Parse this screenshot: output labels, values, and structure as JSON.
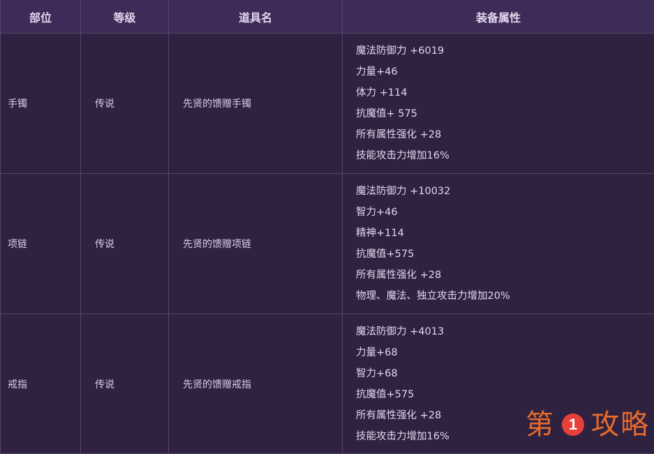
{
  "headers": [
    "部位",
    "等级",
    "道具名",
    "装备属性"
  ],
  "rows": [
    {
      "part": "手镯",
      "grade": "传说",
      "item": "先贤的馈赠手镯",
      "stats": [
        "魔法防御力 +6019",
        "力量+46",
        "体力 +114",
        "抗魔值+ 575",
        "所有属性强化 +28",
        "技能攻击力增加16%"
      ]
    },
    {
      "part": "项链",
      "grade": "传说",
      "item": "先贤的馈赠项链",
      "stats": [
        "魔法防御力 +10032",
        "智力+46",
        "精神+114",
        "抗魔值+575",
        "所有属性强化 +28",
        "物理、魔法、独立攻击力增加20%"
      ]
    },
    {
      "part": "戒指",
      "grade": "传说",
      "item": "先贤的馈赠戒指",
      "stats": [
        "魔法防御力 +4013",
        "力量+68",
        "智力+68",
        "抗魔值+575",
        "所有属性强化 +28",
        "技能攻击力增加16%"
      ]
    }
  ],
  "watermark": {
    "left": "第",
    "number": "1",
    "right": "攻略"
  },
  "colors": {
    "background": "#2e2140",
    "header": "#3f2b57",
    "border": "#56456a",
    "watermark_text": "#e66a2c",
    "watermark_circle": "#e8403a"
  }
}
